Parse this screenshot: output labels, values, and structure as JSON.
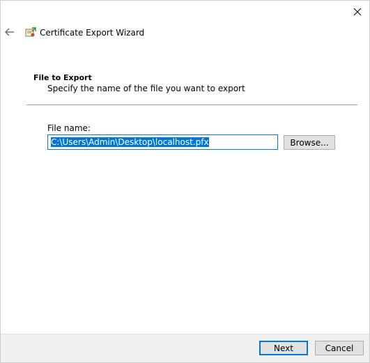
{
  "window": {
    "title": "Certificate Export Wizard"
  },
  "icons": {
    "close": "close-icon",
    "back": "back-arrow-icon",
    "wizard": "certificate-wizard-icon"
  },
  "section": {
    "heading": "File to Export",
    "description": "Specify the name of the file you want to export"
  },
  "file": {
    "label": "File name:",
    "value": "C:\\Users\\Admin\\Desktop\\localhost.pfx"
  },
  "buttons": {
    "browse": "Browse...",
    "next": "Next",
    "cancel": "Cancel"
  },
  "colors": {
    "accent": "#0078d7",
    "button_face": "#e1e1e1",
    "footer_bg": "#f0f0f0"
  }
}
